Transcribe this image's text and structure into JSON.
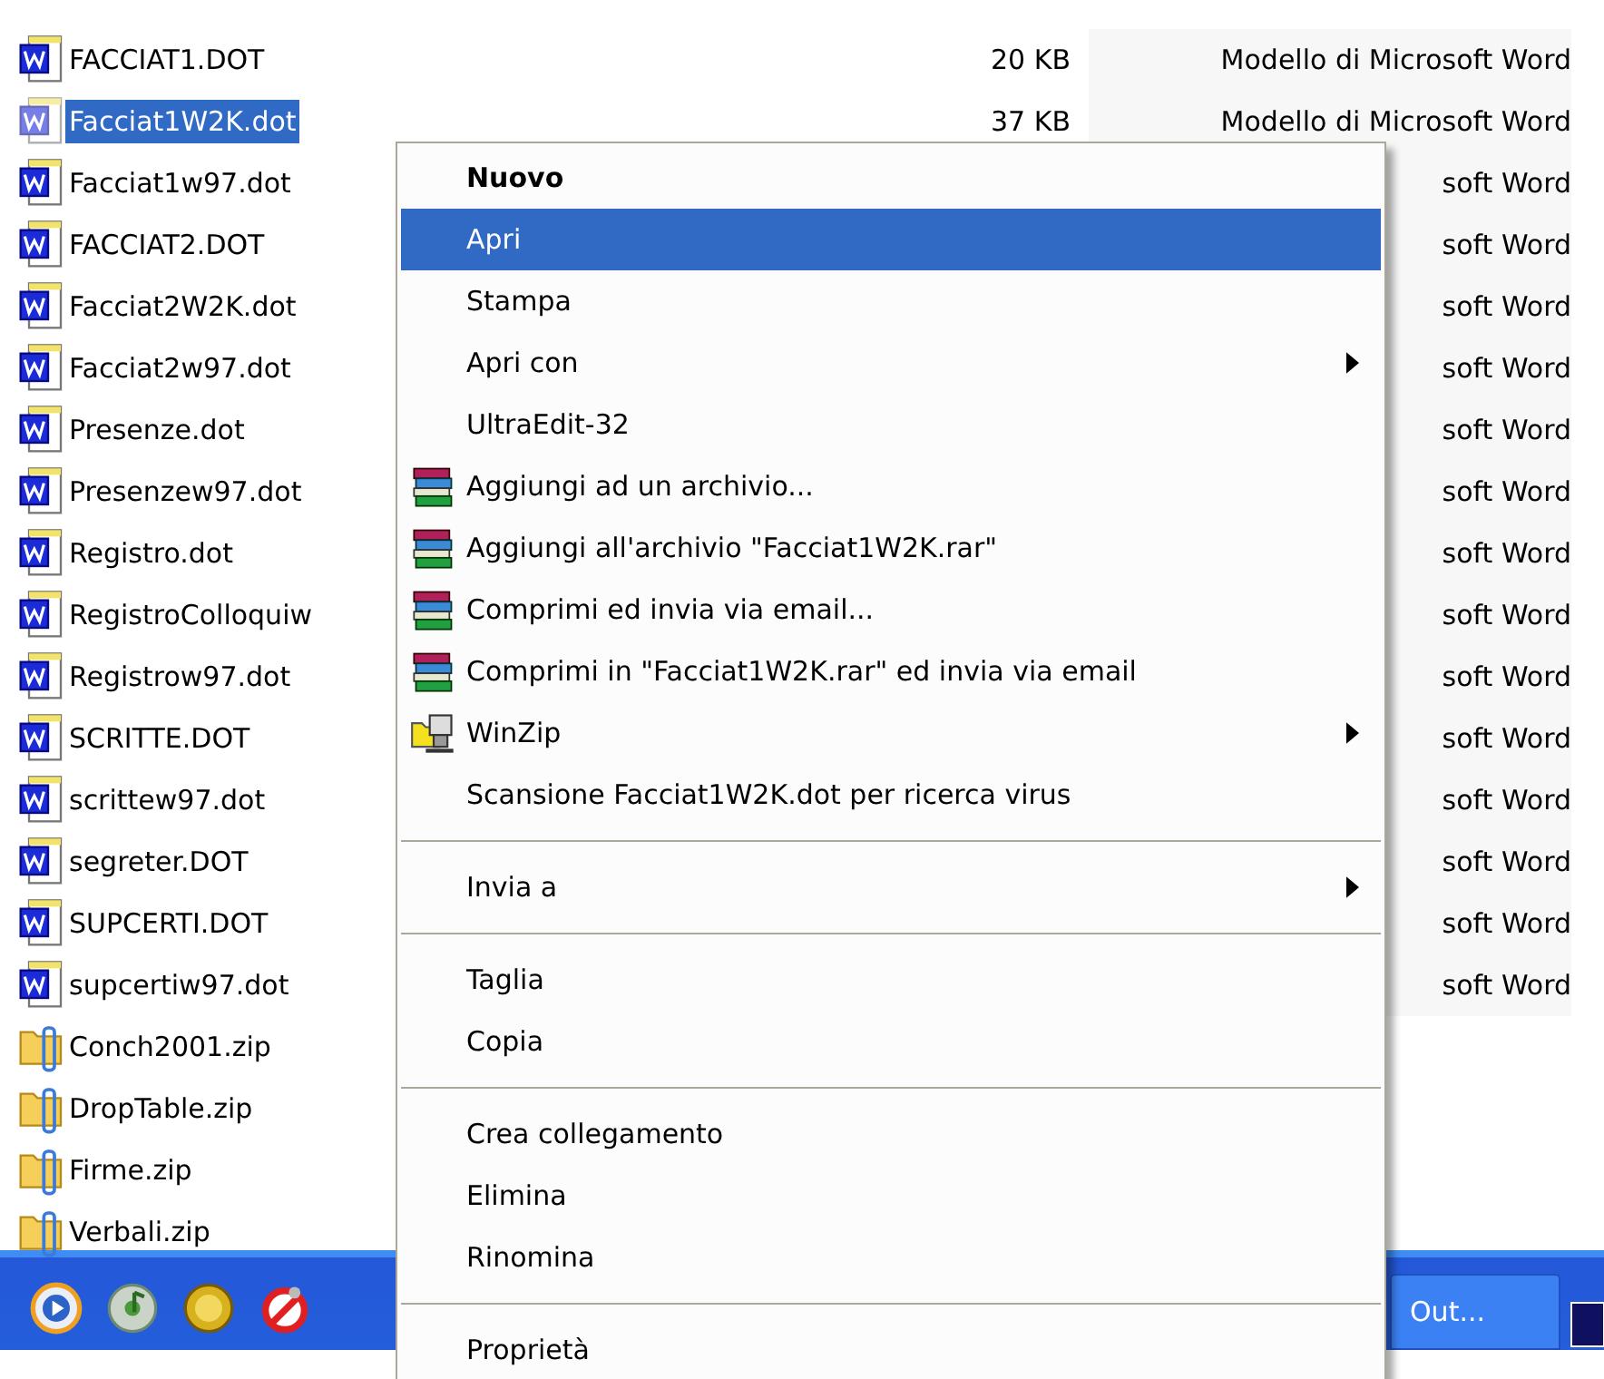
{
  "files": [
    {
      "name": "FACCIAT1.DOT",
      "kind": "word",
      "selected": false,
      "size": "20 KB",
      "type": "Modello di Microsoft Word"
    },
    {
      "name": "Facciat1W2K.dot",
      "kind": "word",
      "selected": true,
      "size": "37 KB",
      "type": "Modello di Microsoft Word"
    },
    {
      "name": "Facciat1w97.dot",
      "kind": "word",
      "selected": false,
      "type": "soft Word"
    },
    {
      "name": "FACCIAT2.DOT",
      "kind": "word",
      "selected": false,
      "type": "soft Word"
    },
    {
      "name": "Facciat2W2K.dot",
      "kind": "word",
      "selected": false,
      "type": "soft Word"
    },
    {
      "name": "Facciat2w97.dot",
      "kind": "word",
      "selected": false,
      "type": "soft Word"
    },
    {
      "name": "Presenze.dot",
      "kind": "word",
      "selected": false,
      "type": "soft Word"
    },
    {
      "name": "Presenzew97.dot",
      "kind": "word",
      "selected": false,
      "type": "soft Word"
    },
    {
      "name": "Registro.dot",
      "kind": "word",
      "selected": false,
      "type": "soft Word"
    },
    {
      "name": "RegistroColloquiw",
      "kind": "word",
      "selected": false,
      "type": "soft Word"
    },
    {
      "name": "Registrow97.dot",
      "kind": "word",
      "selected": false,
      "type": "soft Word"
    },
    {
      "name": "SCRITTE.DOT",
      "kind": "word",
      "selected": false,
      "type": "soft Word"
    },
    {
      "name": "scrittew97.dot",
      "kind": "word",
      "selected": false,
      "type": "soft Word"
    },
    {
      "name": "segreter.DOT",
      "kind": "word",
      "selected": false,
      "type": "soft Word"
    },
    {
      "name": "SUPCERTI.DOT",
      "kind": "word",
      "selected": false,
      "type": "soft Word"
    },
    {
      "name": "supcertiw97.dot",
      "kind": "word",
      "selected": false,
      "type": "soft Word"
    },
    {
      "name": "Conch2001.zip",
      "kind": "zip",
      "selected": false
    },
    {
      "name": "DropTable.zip",
      "kind": "zip",
      "selected": false
    },
    {
      "name": "Firme.zip",
      "kind": "zip",
      "selected": false
    },
    {
      "name": "Verbali.zip",
      "kind": "zip",
      "selected": false
    }
  ],
  "context_menu": {
    "items": [
      {
        "kind": "item",
        "label": "Nuovo",
        "bold": true,
        "selected": false,
        "submenu": false
      },
      {
        "kind": "item",
        "label": "Apri",
        "bold": false,
        "selected": true,
        "submenu": false
      },
      {
        "kind": "item",
        "label": "Stampa",
        "bold": false,
        "selected": false,
        "submenu": false
      },
      {
        "kind": "item",
        "label": "Apri con",
        "bold": false,
        "selected": false,
        "submenu": true
      },
      {
        "kind": "item",
        "label": "UltraEdit-32",
        "bold": false,
        "selected": false,
        "submenu": false
      },
      {
        "kind": "archive",
        "label": "Aggiungi ad un archivio...",
        "bold": false,
        "selected": false,
        "submenu": false
      },
      {
        "kind": "archive",
        "label": "Aggiungi all'archivio \"Facciat1W2K.rar\"",
        "bold": false,
        "selected": false,
        "submenu": false
      },
      {
        "kind": "archive",
        "label": "Comprimi ed invia via email...",
        "bold": false,
        "selected": false,
        "submenu": false
      },
      {
        "kind": "archive",
        "label": "Comprimi in \"Facciat1W2K.rar\" ed invia via email",
        "bold": false,
        "selected": false,
        "submenu": false
      },
      {
        "kind": "winzip",
        "label": "WinZip",
        "bold": false,
        "selected": false,
        "submenu": true
      },
      {
        "kind": "item",
        "label": "Scansione Facciat1W2K.dot per ricerca virus",
        "bold": false,
        "selected": false,
        "submenu": false
      },
      {
        "kind": "separator"
      },
      {
        "kind": "item",
        "label": "Invia a",
        "bold": false,
        "selected": false,
        "submenu": true
      },
      {
        "kind": "separator"
      },
      {
        "kind": "item",
        "label": "Taglia",
        "bold": false,
        "selected": false,
        "submenu": false
      },
      {
        "kind": "item",
        "label": "Copia",
        "bold": false,
        "selected": false,
        "submenu": false
      },
      {
        "kind": "separator"
      },
      {
        "kind": "item",
        "label": "Crea collegamento",
        "bold": false,
        "selected": false,
        "submenu": false
      },
      {
        "kind": "item",
        "label": "Elimina",
        "bold": false,
        "selected": false,
        "submenu": false
      },
      {
        "kind": "item",
        "label": "Rinomina",
        "bold": false,
        "selected": false,
        "submenu": false
      },
      {
        "kind": "separator"
      },
      {
        "kind": "item",
        "label": "Proprietà",
        "bold": false,
        "selected": false,
        "submenu": false
      }
    ]
  },
  "taskbar": {
    "button": "Out..."
  }
}
